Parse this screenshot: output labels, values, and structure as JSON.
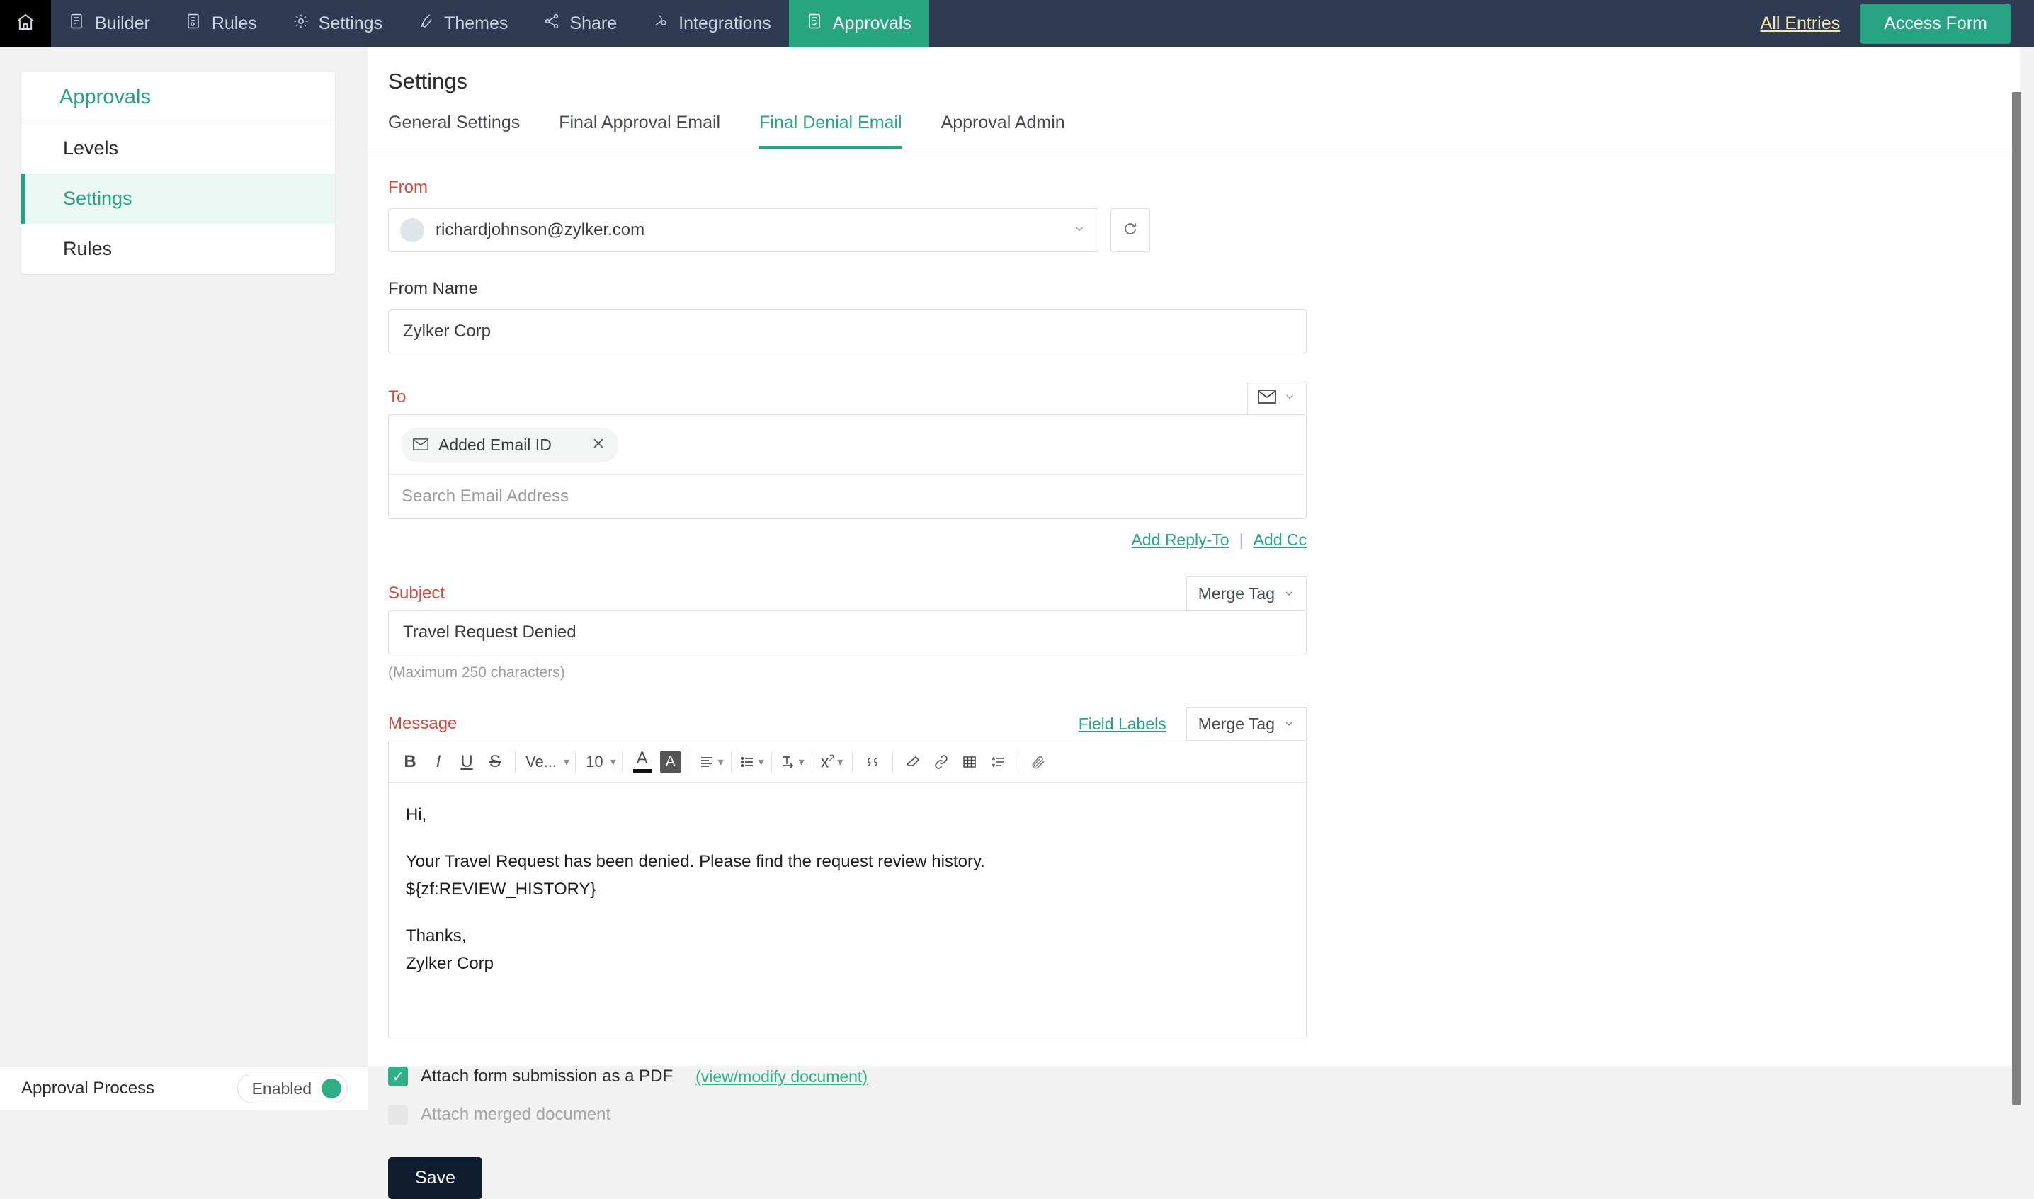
{
  "topbar": {
    "home_icon": "home-icon",
    "nav": [
      {
        "label": "Builder",
        "icon": "form-builder-icon",
        "active": false
      },
      {
        "label": "Rules",
        "icon": "rules-icon",
        "active": false
      },
      {
        "label": "Settings",
        "icon": "gear-icon",
        "active": false
      },
      {
        "label": "Themes",
        "icon": "brush-icon",
        "active": false
      },
      {
        "label": "Share",
        "icon": "share-icon",
        "active": false
      },
      {
        "label": "Integrations",
        "icon": "integrations-icon",
        "active": false
      },
      {
        "label": "Approvals",
        "icon": "approvals-icon",
        "active": true
      }
    ],
    "all_entries": "All Entries",
    "access_form": "Access Form",
    "bg_color": "#2f3b52",
    "accent_color": "#27a383",
    "link_color": "#f6e6b0"
  },
  "sidebar": {
    "title": "Approvals",
    "items": [
      {
        "label": "Levels",
        "active": false
      },
      {
        "label": "Settings",
        "active": true
      },
      {
        "label": "Rules",
        "active": false
      }
    ]
  },
  "main": {
    "page_title": "Settings",
    "tabs": [
      {
        "label": "General Settings",
        "active": false
      },
      {
        "label": "Final Approval Email",
        "active": false
      },
      {
        "label": "Final Denial Email",
        "active": true
      },
      {
        "label": "Approval Admin",
        "active": false
      }
    ]
  },
  "form": {
    "from": {
      "label": "From",
      "value": "richardjohnson@zylker.com",
      "avatar_icon": "user-avatar-icon",
      "chevron_icon": "chevron-down-icon",
      "refresh_icon": "refresh-icon"
    },
    "from_name": {
      "label": "From Name",
      "value": "Zylker Corp"
    },
    "to": {
      "label": "To",
      "mail_icon": "envelope-icon",
      "mail_chevron_icon": "chevron-down-icon",
      "chip": {
        "icon": "envelope-icon",
        "label": "Added Email ID",
        "remove_icon": "close-icon"
      },
      "search_placeholder": "Search Email Address",
      "add_reply_to": "Add Reply-To",
      "separator": "|",
      "add_cc": "Add Cc"
    },
    "subject": {
      "label": "Subject",
      "merge_tag": "Merge Tag",
      "merge_tag_chevron": "chevron-down-icon",
      "value": "Travel Request Denied",
      "hint": "(Maximum 250 characters)"
    },
    "message": {
      "label": "Message",
      "field_labels": "Field Labels",
      "merge_tag": "Merge Tag",
      "merge_tag_chevron": "chevron-down-icon",
      "toolbar": [
        {
          "name": "bold-icon",
          "glyph": "B",
          "style": "bold"
        },
        {
          "name": "italic-icon",
          "glyph": "I",
          "style": "italic"
        },
        {
          "name": "underline-icon",
          "glyph": "U",
          "style": "underline"
        },
        {
          "name": "strikethrough-icon",
          "glyph": "S",
          "style": "strike"
        },
        {
          "name": "font-family-select",
          "glyph": "Ve...",
          "style": "select"
        },
        {
          "name": "font-size-select",
          "glyph": "10",
          "style": "select"
        },
        {
          "name": "font-color-icon",
          "glyph": "A",
          "style": "color"
        },
        {
          "name": "highlight-color-icon",
          "glyph": "A",
          "style": "highlight"
        },
        {
          "name": "align-icon",
          "glyph": "align",
          "style": "svgcaret"
        },
        {
          "name": "bullet-list-icon",
          "glyph": "list",
          "style": "svgcaret"
        },
        {
          "name": "indent-icon",
          "glyph": "indent",
          "style": "svgcaret"
        },
        {
          "name": "superscript-icon",
          "glyph": "x2",
          "style": "svgcaret"
        },
        {
          "name": "blockquote-icon",
          "glyph": "quote",
          "style": "svg"
        },
        {
          "name": "clear-format-icon",
          "glyph": "eraser",
          "style": "svg"
        },
        {
          "name": "link-icon",
          "glyph": "link",
          "style": "svg"
        },
        {
          "name": "table-icon",
          "glyph": "table",
          "style": "svg"
        },
        {
          "name": "line-height-icon",
          "glyph": "lineheight",
          "style": "svg"
        },
        {
          "name": "attachment-icon",
          "glyph": "paperclip",
          "style": "svg"
        }
      ],
      "body": {
        "line1": "Hi,",
        "line2": "Your Travel Request has been denied. Please find the request review history.",
        "line3": "${zf:REVIEW_HISTORY}",
        "line4": "Thanks,",
        "line5": "Zylker Corp"
      }
    },
    "attachments": {
      "pdf_label": "Attach form submission as a PDF",
      "pdf_link": "(view/modify document)",
      "pdf_checked": true,
      "merged_label": "Attach merged document",
      "merged_checked": false,
      "check_glyph": "✓"
    },
    "save_label": "Save"
  },
  "bottombar": {
    "label": "Approval Process",
    "toggle_state": "Enabled",
    "toggle_color": "#2eb086"
  }
}
